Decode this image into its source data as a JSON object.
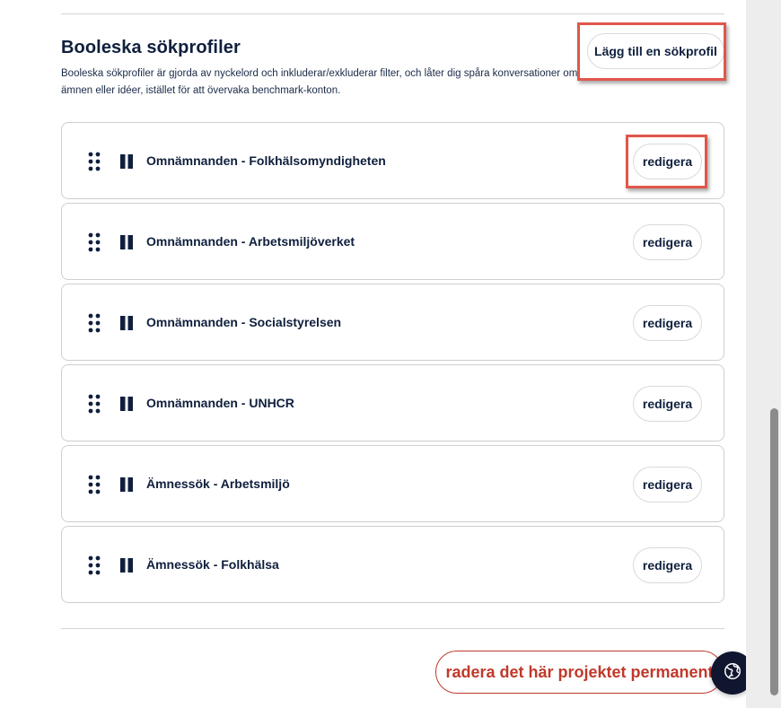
{
  "section": {
    "title": "Booleska sökprofiler",
    "description": "Booleska sökprofiler är gjorda av nyckelord och inkluderar/exkluderar filter, och låter dig spåra konversationer om ämnen eller idéer, istället för att övervaka benchmark-konton.",
    "add_button_label": "Lägg till en sökprofil"
  },
  "profiles": [
    {
      "name": "Omnämnanden - Folkhälsomyndigheten",
      "edit_label": "redigera",
      "status_icon": "pause-icon"
    },
    {
      "name": "Omnämnanden - Arbetsmiljöverket",
      "edit_label": "redigera",
      "status_icon": "pause-icon"
    },
    {
      "name": "Omnämnanden - Socialstyrelsen",
      "edit_label": "redigera",
      "status_icon": "pause-icon"
    },
    {
      "name": "Omnämnanden - UNHCR",
      "edit_label": "redigera",
      "status_icon": "pause-icon"
    },
    {
      "name": "Ämnessök - Arbetsmiljö",
      "edit_label": "redigera",
      "status_icon": "pause-icon"
    },
    {
      "name": "Ämnessök - Folkhälsa",
      "edit_label": "redigera",
      "status_icon": "pause-icon"
    }
  ],
  "footer": {
    "delete_label": "radera det här projektet permanent",
    "fab_icon": "globe-icon"
  },
  "colors": {
    "text": "#0f1f3d",
    "danger": "#c0392b",
    "highlight": "#e0574b",
    "fab_bg": "#10162f"
  }
}
